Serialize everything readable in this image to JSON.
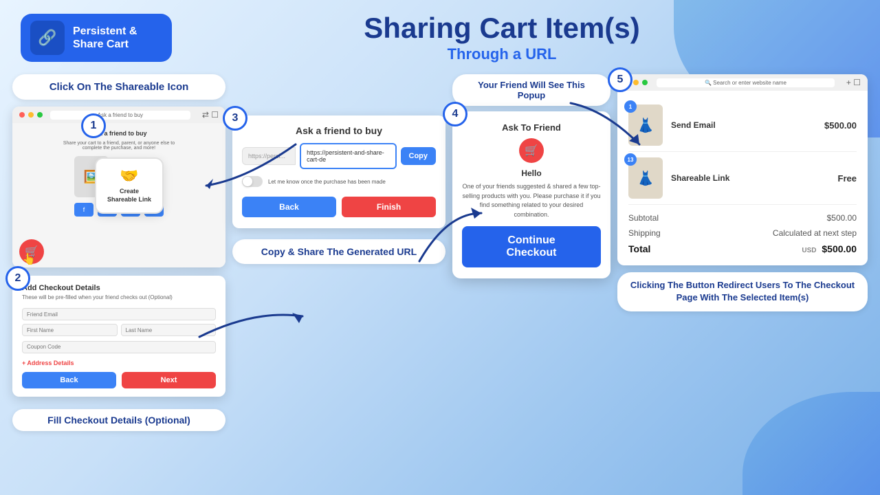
{
  "header": {
    "logo": {
      "line1": "Persistent &",
      "line2": "Share Cart",
      "icon": "🔗"
    },
    "title": "Sharing Cart Item(s)",
    "subtitle": "Through a URL"
  },
  "labels": {
    "click_icon": "Click On The Shareable Icon",
    "fill_checkout": "Fill Checkout Details (Optional)",
    "copy_share": "Copy & Share The Generated URL",
    "friend_popup": "Your Friend Will See This Popup",
    "redirect_info": "Clicking The Button Redirect Users To The Checkout Page With The Selected Item(s)"
  },
  "step1": {
    "number": "1",
    "browser_url": "Ask a friend to buy",
    "shareable_text": "Create Shareable Link"
  },
  "step2": {
    "number": "2",
    "title": "Add Checkout Details",
    "desc": "These will be pre-filled when your friend checks out (Optional)",
    "fields": {
      "email": "Friend Email",
      "first_name": "First Name",
      "last_name": "Last Name",
      "coupon": "Coupon Code"
    },
    "address_link": "+ Address Details",
    "back_btn": "Back",
    "next_btn": "Next"
  },
  "step3": {
    "number": "3",
    "panel_title": "Ask a friend to buy",
    "url_placeholder": "https://persi...",
    "url_value": "https://persistent-and-share-cart-de",
    "copy_btn": "Copy",
    "toggle_label": "Let me know once the purchase has been made",
    "back_btn": "Back",
    "finish_btn": "Finish"
  },
  "step4": {
    "number": "4",
    "popup_label": "Your Friend Will See This Popup",
    "popup_title": "Ask To Friend",
    "popup_hello": "Hello",
    "popup_text": "One of your friends suggested & shared a few top-selling products with you. Please purchase it if you find something related to your desired combination.",
    "continue_btn": "Continue Checkout"
  },
  "step5": {
    "number": "5",
    "items": [
      {
        "name": "Send Email",
        "price": "$500.00",
        "badge": "1",
        "emoji": "👗"
      },
      {
        "name": "Shareable Link",
        "price": "Free",
        "badge": "13",
        "emoji": "👗"
      }
    ],
    "subtotal_label": "Subtotal",
    "subtotal_value": "$500.00",
    "shipping_label": "Shipping",
    "shipping_value": "Calculated at next step",
    "total_label": "Total",
    "total_currency": "USD",
    "total_value": "$500.00"
  }
}
